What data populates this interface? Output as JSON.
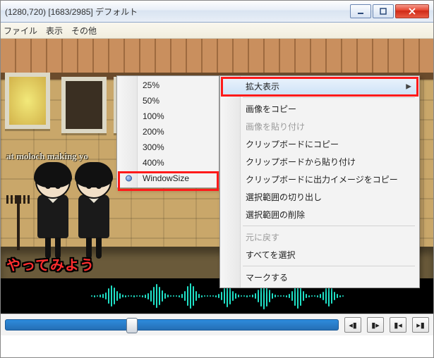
{
  "title": "(1280,720)  [1683/2985]  デフォルト",
  "menubar": {
    "file": "ファイル",
    "view": "表示",
    "other": "その他"
  },
  "subtitle_top": "at moloch making yo",
  "subtitle_bottom": "やってみよう",
  "zoom_menu": {
    "items": [
      "25%",
      "50%",
      "100%",
      "200%",
      "300%",
      "400%",
      "WindowSize"
    ],
    "selected_index": 6
  },
  "context_menu": {
    "zoom": "拡大表示",
    "copy_image": "画像をコピー",
    "paste_image": "画像を貼り付け",
    "clip_copy": "クリップボードにコピー",
    "clip_paste": "クリップボードから貼り付け",
    "clip_out": "クリップボードに出力イメージをコピー",
    "cut_sel": "選択範囲の切り出し",
    "del_sel": "選択範囲の削除",
    "undo": "元に戻す",
    "sel_all": "すべてを選択",
    "mark": "マークする"
  },
  "transport": {
    "prev_frame": "◀|",
    "next_frame": "|▶",
    "first": "|◀",
    "last": "▶|"
  }
}
